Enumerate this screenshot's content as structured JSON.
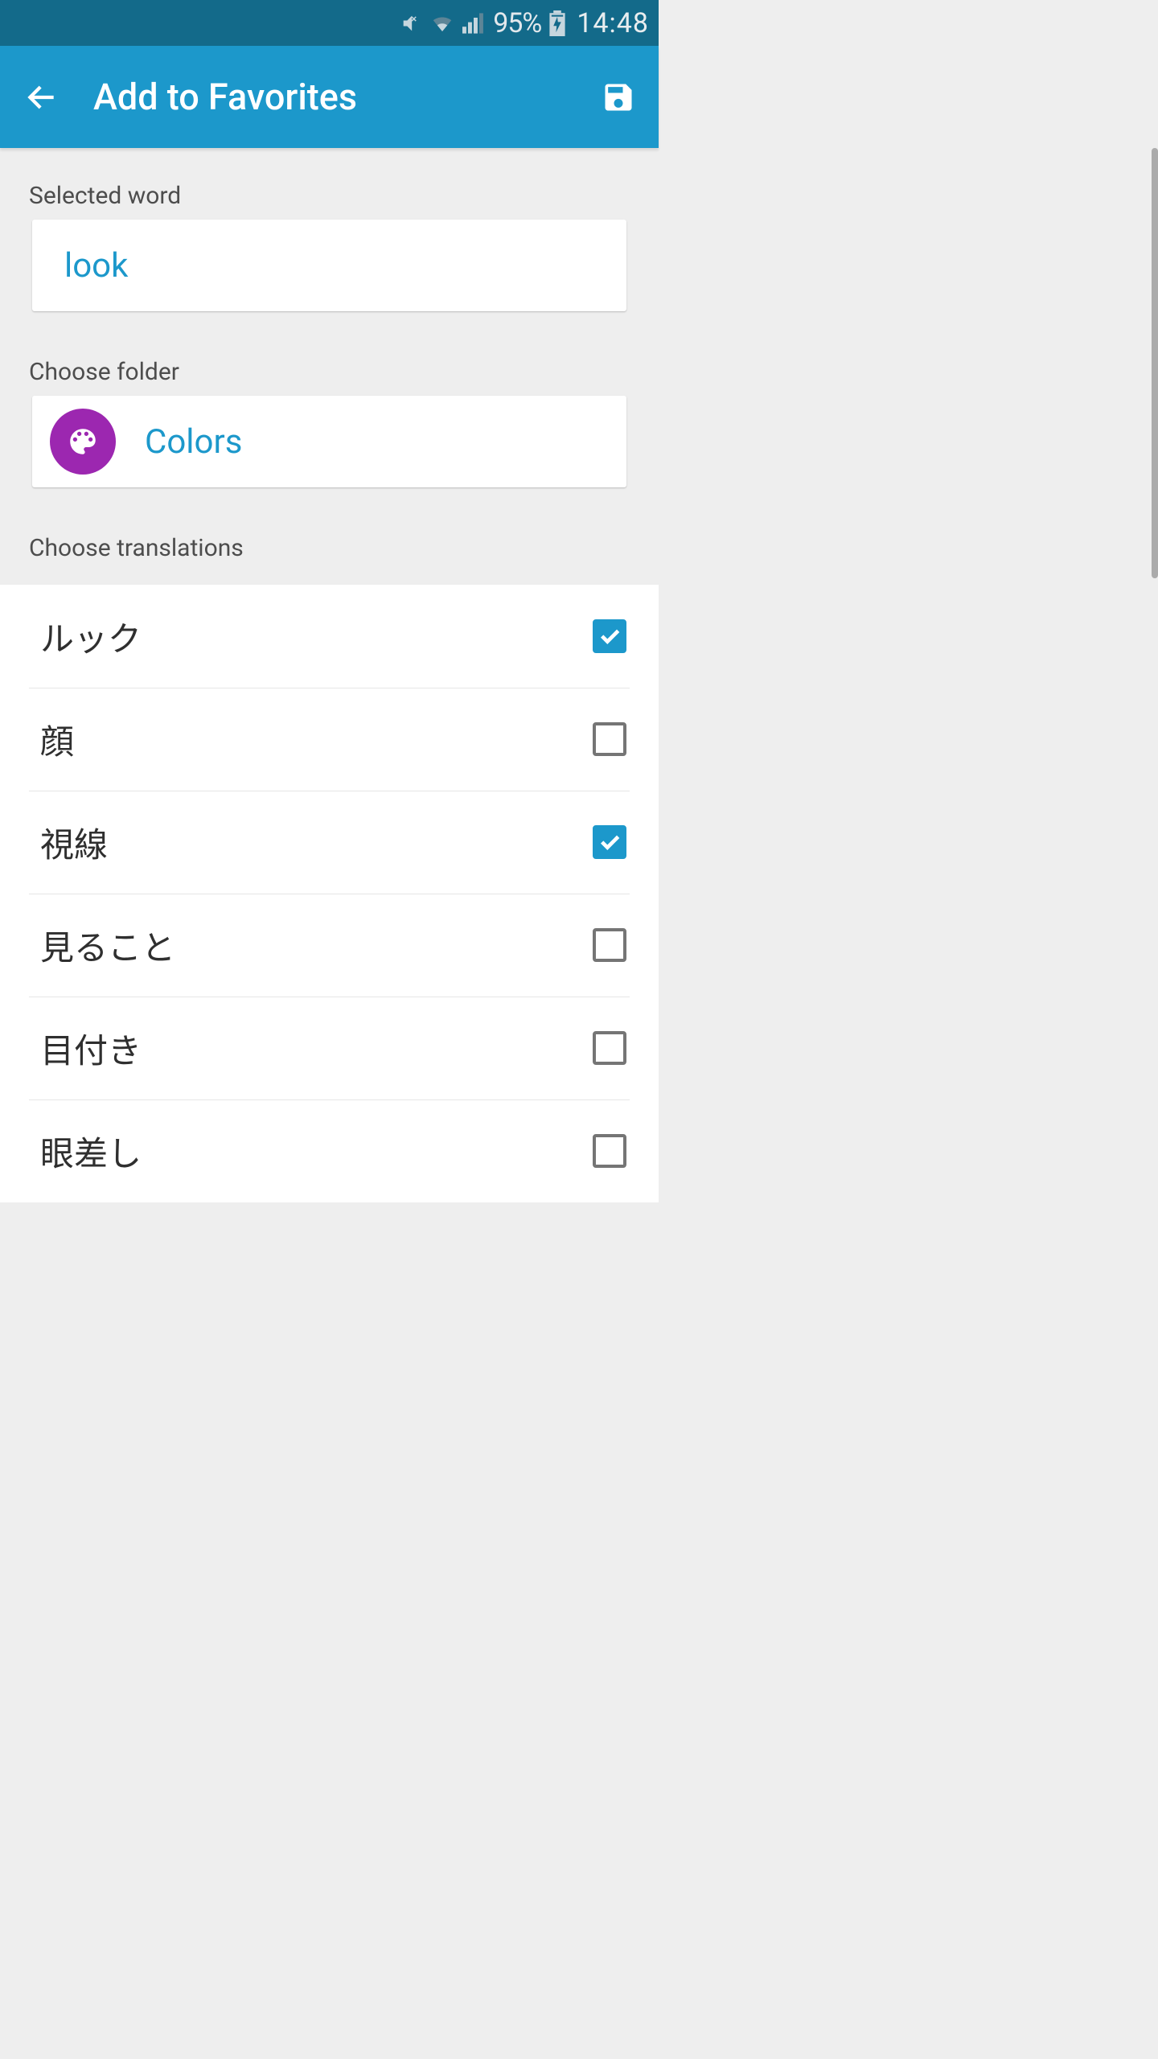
{
  "status": {
    "battery_pct": "95%",
    "time": "14:48"
  },
  "header": {
    "title": "Add to Favorites"
  },
  "selected_word": {
    "label": "Selected word",
    "value": "look"
  },
  "folder": {
    "label": "Choose folder",
    "name": "Colors",
    "icon": "palette-icon",
    "color": "#9c27b0"
  },
  "translations": {
    "label": "Choose translations",
    "items": [
      {
        "text": "ルック",
        "checked": true
      },
      {
        "text": "顔",
        "checked": false
      },
      {
        "text": "視線",
        "checked": true
      },
      {
        "text": "見ること",
        "checked": false
      },
      {
        "text": "目付き",
        "checked": false
      },
      {
        "text": "眼差し",
        "checked": false
      }
    ]
  },
  "colors": {
    "accent": "#1c98cb",
    "status_bar": "#136a8a",
    "folder_accent": "#9c27b0"
  }
}
